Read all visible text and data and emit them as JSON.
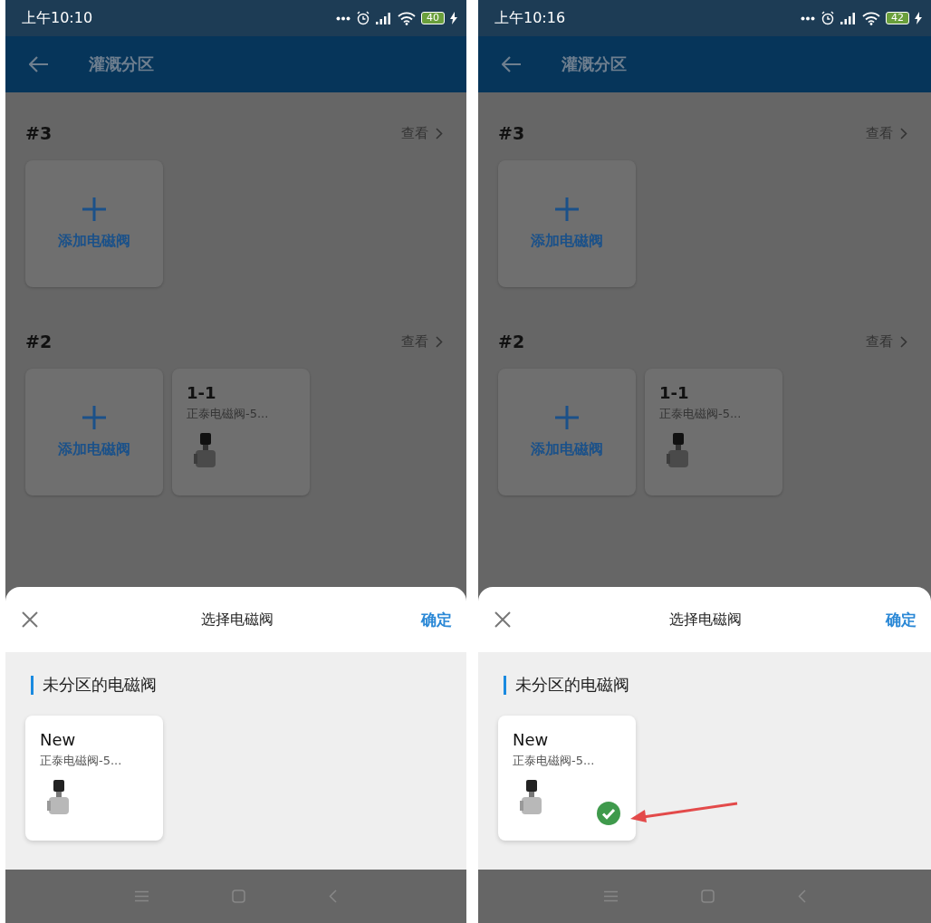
{
  "screens": [
    {
      "status_bar": {
        "time": "上午10:10",
        "battery": "40"
      },
      "app_bar": {
        "title": "灌溉分区"
      },
      "zones": [
        {
          "name": "#3",
          "view_link": "查看",
          "add_label": "添加电磁阀"
        },
        {
          "name": "#2",
          "view_link": "查看",
          "add_label": "添加电磁阀",
          "valves": [
            {
              "name": "1-1",
              "model": "正泰电磁阀-5..."
            }
          ]
        }
      ],
      "sheet": {
        "title": "选择电磁阀",
        "confirm": "确定",
        "section_title": "未分区的电磁阀",
        "valves": [
          {
            "name": "New",
            "model": "正泰电磁阀-5...",
            "selected": false
          }
        ]
      },
      "annotation_arrow": false
    },
    {
      "status_bar": {
        "time": "上午10:16",
        "battery": "42"
      },
      "app_bar": {
        "title": "灌溉分区"
      },
      "zones": [
        {
          "name": "#3",
          "view_link": "查看",
          "add_label": "添加电磁阀"
        },
        {
          "name": "#2",
          "view_link": "查看",
          "add_label": "添加电磁阀",
          "valves": [
            {
              "name": "1-1",
              "model": "正泰电磁阀-5..."
            }
          ]
        }
      ],
      "sheet": {
        "title": "选择电磁阀",
        "confirm": "确定",
        "section_title": "未分区的电磁阀",
        "valves": [
          {
            "name": "New",
            "model": "正泰电磁阀-5...",
            "selected": true
          }
        ]
      },
      "annotation_arrow": true
    }
  ]
}
